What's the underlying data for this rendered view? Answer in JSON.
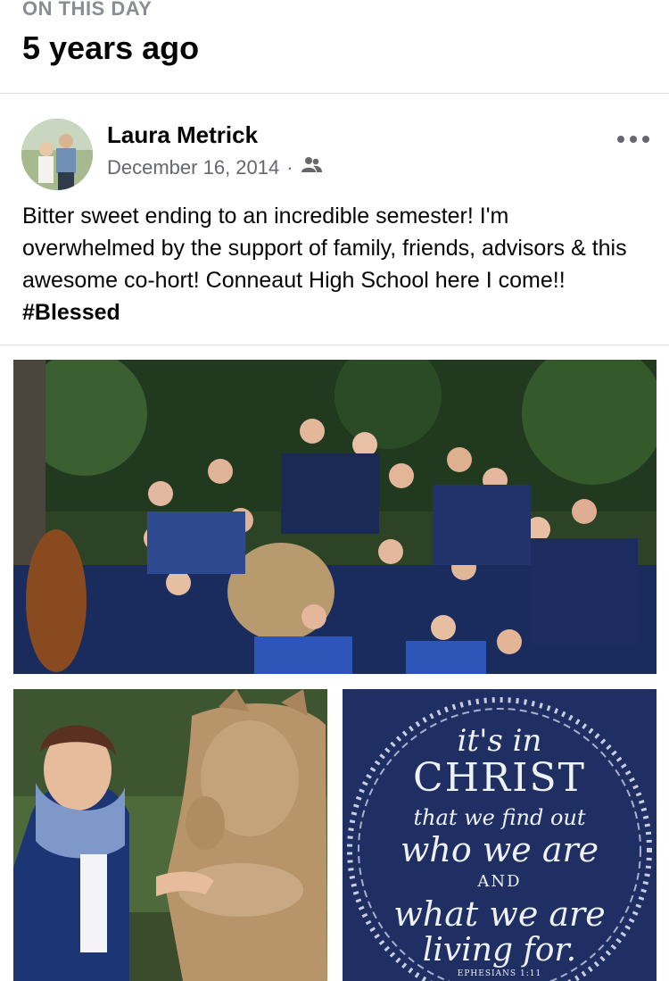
{
  "section": {
    "label": "ON THIS DAY",
    "title": "5 years ago"
  },
  "post": {
    "author": "Laura Metrick",
    "date": "December 16, 2014",
    "separator": "·",
    "audience_icon": "friends-icon",
    "more_icon": "more-options-icon",
    "text": "Bitter sweet ending to an incredible semester! I'm overwhelmed by the support of family, friends, advisors & this awesome co-hort! Conneaut High School here I come!! ",
    "hashtag": "#Blessed"
  },
  "photos": {
    "quote_lines": [
      "it's in",
      "CHRIST",
      "that we find out",
      "who we are",
      "AND",
      "what we are",
      "living for.",
      "EPHESIANS 1:11"
    ]
  },
  "colors": {
    "accent_gray": "#65676b",
    "divider": "#dadde1"
  }
}
